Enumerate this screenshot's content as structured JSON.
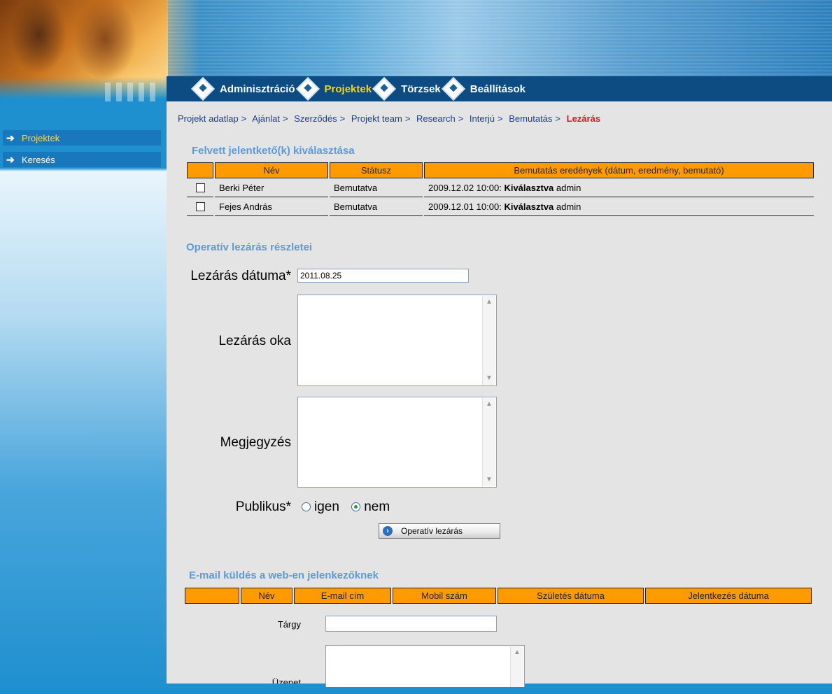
{
  "nav": {
    "items": [
      {
        "label": "Adminisztráció",
        "active": false
      },
      {
        "label": "Projektek",
        "active": true
      },
      {
        "label": "Törzsek",
        "active": false
      },
      {
        "label": "Beállítások",
        "active": false
      }
    ]
  },
  "sidebar": {
    "items": [
      {
        "label": "Projektek",
        "active": true
      },
      {
        "label": "Keresés",
        "active": false
      }
    ]
  },
  "breadcrumb": {
    "items": [
      "Projekt adatlap",
      "Ajánlat",
      "Szerződés",
      "Projekt team",
      "Research",
      "Interjú",
      "Bemutatás"
    ],
    "separator": ">",
    "current": "Lezárás"
  },
  "candidates": {
    "title": "Felvett jelentkető(k) kiválasztása",
    "columns": [
      "",
      "Név",
      "Státusz",
      "Bemutatás eredények (dátum, eredmény, bemutató)"
    ],
    "rows": [
      {
        "name": "Berki Péter",
        "status": "Bemutatva",
        "date": "2009.12.02 10:00:",
        "result": "Kiválasztva",
        "by": "admin"
      },
      {
        "name": "Fejes András",
        "status": "Bemutatva",
        "date": "2009.12.01 10:00:",
        "result": "Kiválasztva",
        "by": "admin"
      }
    ]
  },
  "closing": {
    "title": "Operatív lezárás részletei",
    "date_label": "Lezárás dátuma*",
    "date_value": "2011.08.25",
    "reason_label": "Lezárás oka",
    "note_label": "Megjegyzés",
    "public_label": "Publikus*",
    "public_options": [
      "igen",
      "nem"
    ],
    "public_selected": "nem",
    "button_label": "Operatív lezárás"
  },
  "email": {
    "title": "E-mail küldés a web-en jelenkezőknek",
    "columns": [
      "",
      "Név",
      "E-mail cím",
      "Mobil szám",
      "Születés dátuma",
      "Jelentkezés dátuma"
    ],
    "subject_label": "Tárgy",
    "message_label": "Üzenet"
  },
  "colors": {
    "accent_orange": "#ff9a00",
    "nav_bg": "#0d4c82",
    "section_title": "#5d9ad8",
    "current_crumb": "#d11a1a"
  }
}
